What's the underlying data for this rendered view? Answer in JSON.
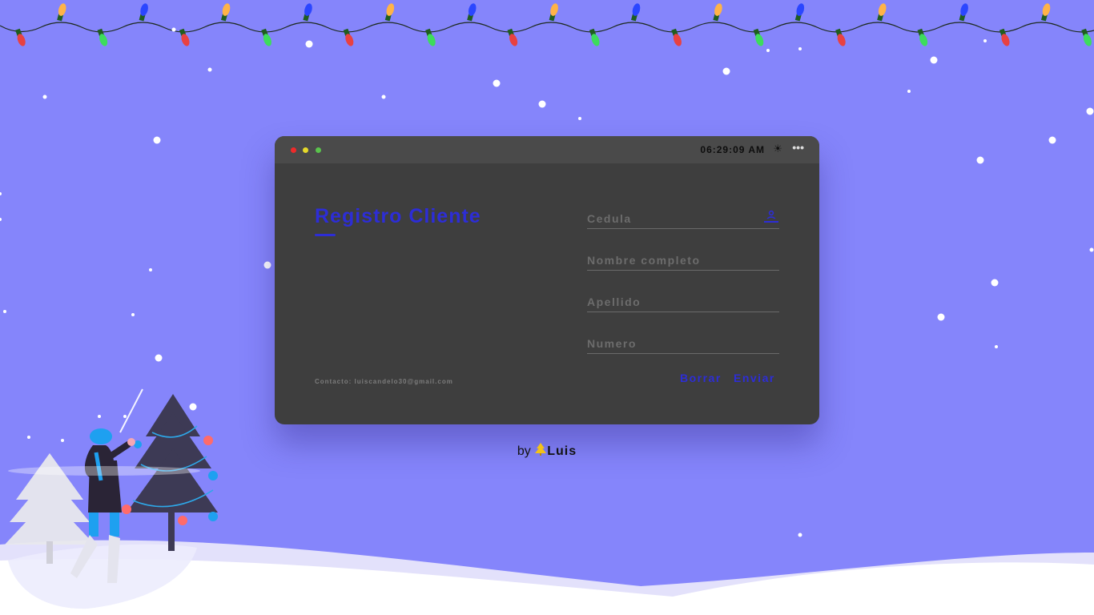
{
  "window": {
    "clock": "06:29:09 AM",
    "icons": [
      "sun-icon",
      "more-icon"
    ],
    "controls": [
      "close-dot",
      "minimize-dot",
      "maximize-dot"
    ]
  },
  "form": {
    "title": "Registro Cliente",
    "fields": [
      {
        "name": "cedula",
        "placeholder": "Cedula",
        "value": ""
      },
      {
        "name": "nombre",
        "placeholder": "Nombre completo",
        "value": ""
      },
      {
        "name": "apellido",
        "placeholder": "Apellido",
        "value": ""
      },
      {
        "name": "numero",
        "placeholder": "Numero",
        "value": ""
      }
    ],
    "contact": "Contacto: luiscandelo30@gmail.com",
    "buttons": {
      "reset": "Borrar",
      "submit": "Enviar"
    }
  },
  "footer": {
    "by": "by",
    "author": "Luis"
  },
  "colors": {
    "background": "#8585fb",
    "card": "#3e3e3e",
    "titlebar": "#4a4a4a",
    "accent": "#2d2dd6",
    "snow": "#ffffff"
  }
}
